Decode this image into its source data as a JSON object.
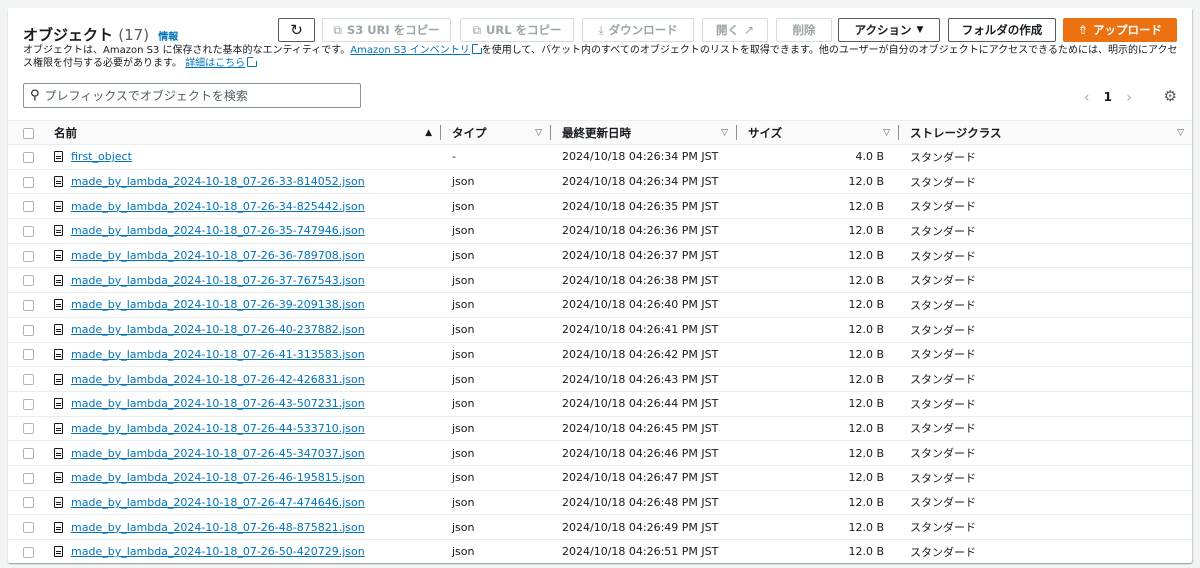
{
  "header": {
    "title": "オブジェクト",
    "count": "(17)",
    "info": "情報"
  },
  "toolbar": {
    "refresh_icon": "refresh-icon",
    "copy_s3_uri": "S3 URI をコピー",
    "copy_url": "URL をコピー",
    "download": "ダウンロード",
    "open": "開く",
    "delete": "削除",
    "actions": "アクション",
    "create_folder": "フォルダの作成",
    "upload": "アップロード"
  },
  "description": {
    "part1": "オブジェクトは、Amazon S3 に保存された基本的なエンティティです。",
    "inventory_link": "Amazon S3 インベントリ",
    "part2": "を使用して、バケット内のすべてのオブジェクトのリストを取得できます。他のユーザーが自分のオブジェクトにアクセスできるためには、明示的にアクセス権限を付与する必要があります。",
    "details_link": "詳細はこちら"
  },
  "search": {
    "placeholder": "プレフィックスでオブジェクトを検索"
  },
  "pagination": {
    "page": "1"
  },
  "table": {
    "columns": {
      "name": "名前",
      "type": "タイプ",
      "last_modified": "最終更新日時",
      "size": "サイズ",
      "storage_class": "ストレージクラス"
    },
    "rows": [
      {
        "name": "first_object",
        "type": "-",
        "modified": "2024/10/18 04:26:34 PM JST",
        "size": "4.0 B",
        "storage": "スタンダード"
      },
      {
        "name": "made_by_lambda_2024-10-18_07-26-33-814052.json",
        "type": "json",
        "modified": "2024/10/18 04:26:34 PM JST",
        "size": "12.0 B",
        "storage": "スタンダード"
      },
      {
        "name": "made_by_lambda_2024-10-18_07-26-34-825442.json",
        "type": "json",
        "modified": "2024/10/18 04:26:35 PM JST",
        "size": "12.0 B",
        "storage": "スタンダード"
      },
      {
        "name": "made_by_lambda_2024-10-18_07-26-35-747946.json",
        "type": "json",
        "modified": "2024/10/18 04:26:36 PM JST",
        "size": "12.0 B",
        "storage": "スタンダード"
      },
      {
        "name": "made_by_lambda_2024-10-18_07-26-36-789708.json",
        "type": "json",
        "modified": "2024/10/18 04:26:37 PM JST",
        "size": "12.0 B",
        "storage": "スタンダード"
      },
      {
        "name": "made_by_lambda_2024-10-18_07-26-37-767543.json",
        "type": "json",
        "modified": "2024/10/18 04:26:38 PM JST",
        "size": "12.0 B",
        "storage": "スタンダード"
      },
      {
        "name": "made_by_lambda_2024-10-18_07-26-39-209138.json",
        "type": "json",
        "modified": "2024/10/18 04:26:40 PM JST",
        "size": "12.0 B",
        "storage": "スタンダード"
      },
      {
        "name": "made_by_lambda_2024-10-18_07-26-40-237882.json",
        "type": "json",
        "modified": "2024/10/18 04:26:41 PM JST",
        "size": "12.0 B",
        "storage": "スタンダード"
      },
      {
        "name": "made_by_lambda_2024-10-18_07-26-41-313583.json",
        "type": "json",
        "modified": "2024/10/18 04:26:42 PM JST",
        "size": "12.0 B",
        "storage": "スタンダード"
      },
      {
        "name": "made_by_lambda_2024-10-18_07-26-42-426831.json",
        "type": "json",
        "modified": "2024/10/18 04:26:43 PM JST",
        "size": "12.0 B",
        "storage": "スタンダード"
      },
      {
        "name": "made_by_lambda_2024-10-18_07-26-43-507231.json",
        "type": "json",
        "modified": "2024/10/18 04:26:44 PM JST",
        "size": "12.0 B",
        "storage": "スタンダード"
      },
      {
        "name": "made_by_lambda_2024-10-18_07-26-44-533710.json",
        "type": "json",
        "modified": "2024/10/18 04:26:45 PM JST",
        "size": "12.0 B",
        "storage": "スタンダード"
      },
      {
        "name": "made_by_lambda_2024-10-18_07-26-45-347037.json",
        "type": "json",
        "modified": "2024/10/18 04:26:46 PM JST",
        "size": "12.0 B",
        "storage": "スタンダード"
      },
      {
        "name": "made_by_lambda_2024-10-18_07-26-46-195815.json",
        "type": "json",
        "modified": "2024/10/18 04:26:47 PM JST",
        "size": "12.0 B",
        "storage": "スタンダード"
      },
      {
        "name": "made_by_lambda_2024-10-18_07-26-47-474646.json",
        "type": "json",
        "modified": "2024/10/18 04:26:48 PM JST",
        "size": "12.0 B",
        "storage": "スタンダード"
      },
      {
        "name": "made_by_lambda_2024-10-18_07-26-48-875821.json",
        "type": "json",
        "modified": "2024/10/18 04:26:49 PM JST",
        "size": "12.0 B",
        "storage": "スタンダード"
      },
      {
        "name": "made_by_lambda_2024-10-18_07-26-50-420729.json",
        "type": "json",
        "modified": "2024/10/18 04:26:51 PM JST",
        "size": "12.0 B",
        "storage": "スタンダード"
      }
    ]
  },
  "colors": {
    "accent": "#ec7211",
    "link": "#0073bb"
  }
}
